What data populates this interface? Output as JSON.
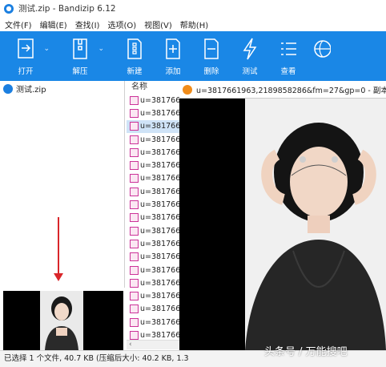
{
  "window": {
    "title": "测试.zip - Bandizip 6.12"
  },
  "menu": [
    "文件(F)",
    "编辑(E)",
    "查找(I)",
    "选项(O)",
    "视图(V)",
    "帮助(H)"
  ],
  "toolbar": {
    "open": "打开",
    "extract": "解压",
    "new": "新建",
    "add": "添加",
    "delete": "删除",
    "test": "测试",
    "view": "查看"
  },
  "tree": {
    "archive": "测试.zip"
  },
  "list": {
    "column_name": "名称",
    "rows": [
      "u=381766",
      "u=381766",
      "u=381766",
      "u=381766",
      "u=381766",
      "u=381766",
      "u=381766",
      "u=381766",
      "u=381766",
      "u=381766",
      "u=381766",
      "u=381766",
      "u=381766",
      "u=381766",
      "u=381766",
      "u=381766",
      "u=381766",
      "u=381766",
      "u=381766"
    ],
    "selected_index": 2
  },
  "viewer": {
    "title": "u=3817661963,2189858286&fm=27&gp=0 - 副本 - 照"
  },
  "status": "已选择 1 个文件, 40.7 KB (压缩后大小: 40.2 KB, 1.3",
  "watermark": "头条号 / 万能搜吧",
  "colors": {
    "toolbar": "#1a87e6",
    "selection": "#cfe3f7",
    "arrow": "#d9262a"
  }
}
